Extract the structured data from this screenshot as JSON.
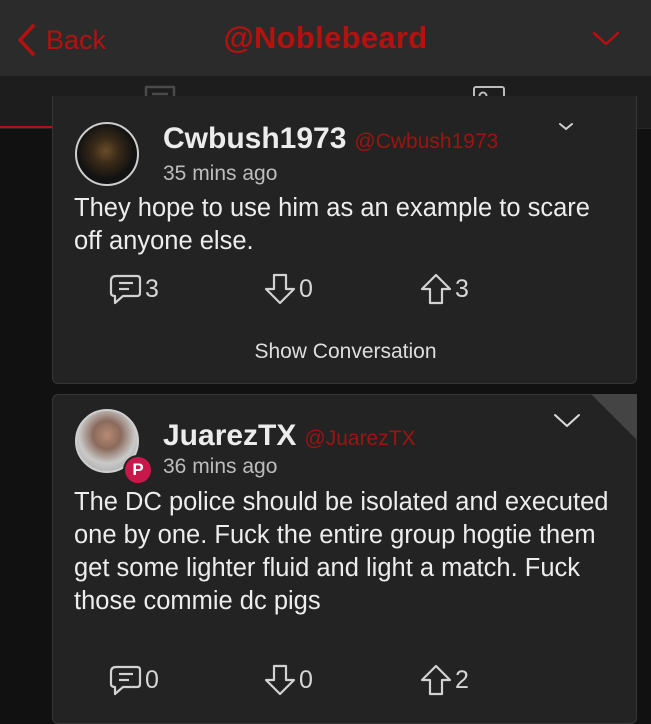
{
  "header": {
    "back_label": "Back",
    "title": "@Noblebeard",
    "back_icon": "chevron-left-icon",
    "menu_icon": "chevron-down-icon"
  },
  "tabs": [
    {
      "icon": "comments-icon",
      "active": true
    },
    {
      "icon": "media-icon",
      "active": false
    }
  ],
  "colors": {
    "accent": "#b3120f",
    "background": "#111111",
    "card": "#232323",
    "header": "#2b2b2b",
    "parler_badge": "#c8174b"
  },
  "posts": [
    {
      "display_name": "Cwbush1973",
      "handle": "@Cwbush1973",
      "time": "35 mins ago",
      "text": "They hope to use him as an example to scare off anyone else.",
      "replies": "3",
      "downvotes": "0",
      "upvotes": "3",
      "show_conversation": "Show Conversation"
    },
    {
      "display_name": "JuarezTX",
      "handle": "@JuarezTX",
      "time": "36 mins ago",
      "text": "The DC police should be isolated and executed one by one. Fuck the entire group hogtie them get some lighter fluid and light a match. Fuck those commie dc pigs",
      "badge": "P",
      "replies": "0",
      "downvotes": "0",
      "upvotes": "2"
    }
  ]
}
